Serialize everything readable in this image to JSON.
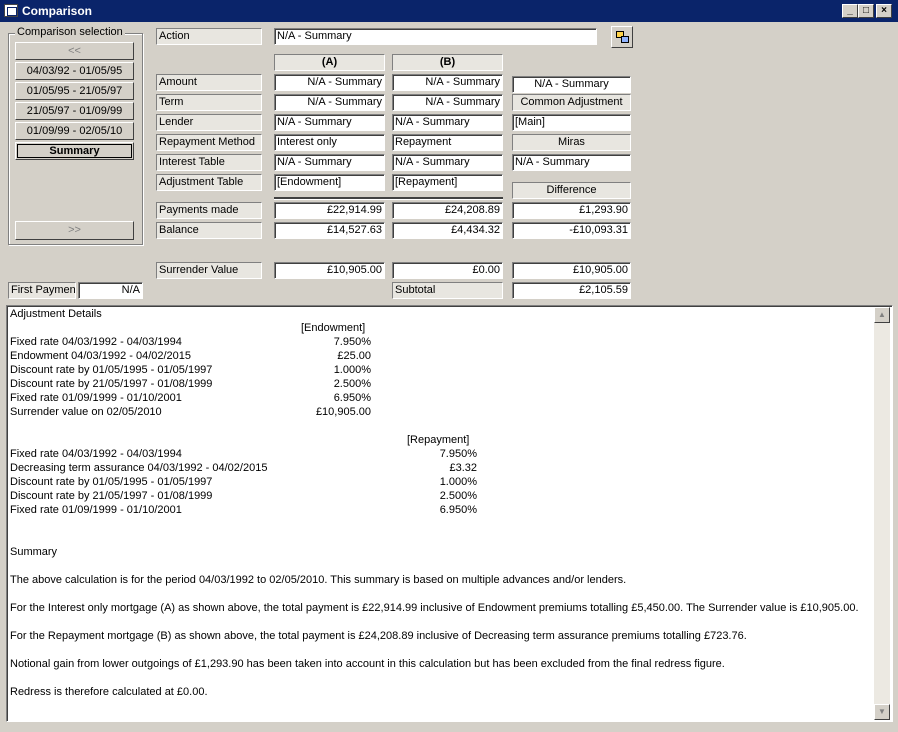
{
  "window": {
    "title": "Comparison",
    "minimize": "_",
    "maximize": "□",
    "close": "×"
  },
  "selection": {
    "label": "Comparison selection",
    "prev": "<<",
    "next": ">>",
    "items": [
      "04/03/92 - 01/05/95",
      "01/05/95 - 21/05/97",
      "21/05/97 - 01/09/99",
      "01/09/99 - 02/05/10",
      "Summary"
    ]
  },
  "action": {
    "label": "Action",
    "value": "N/A - Summary"
  },
  "columns": {
    "a": "(A)",
    "b": "(B)"
  },
  "rows": {
    "amount": {
      "label": "Amount",
      "a": "N/A - Summary",
      "b": "N/A - Summary"
    },
    "term": {
      "label": "Term",
      "a": "N/A - Summary",
      "b": "N/A - Summary"
    },
    "lender": {
      "label": "Lender",
      "a": "N/A - Summary",
      "b": "N/A - Summary"
    },
    "repayment": {
      "label": "Repayment Method",
      "a": "Interest only",
      "b": "Repayment"
    },
    "interest": {
      "label": "Interest Table",
      "a": "N/A - Summary",
      "b": "N/A - Summary"
    },
    "adjustment": {
      "label": "Adjustment Table",
      "a": "[Endowment]",
      "b": "[Repayment]"
    },
    "payments": {
      "label": "Payments made",
      "a": "£22,914.99",
      "b": "£24,208.89",
      "diff": "£1,293.90"
    },
    "balance": {
      "label": "Balance",
      "a": "£14,527.63",
      "b": "£4,434.32",
      "diff": "-£10,093.31"
    },
    "surrender": {
      "label": "Surrender Value",
      "a": "£10,905.00",
      "b": "£0.00",
      "diff": "£10,905.00"
    }
  },
  "right": {
    "amount": "N/A - Summary",
    "common_adjustment_label": "Common Adjustment",
    "common_adjustment": "[Main]",
    "miras_label": "Miras",
    "miras": "N/A - Summary",
    "difference_label": "Difference"
  },
  "first_payment": {
    "label": "First Payment",
    "value": "N/A"
  },
  "subtotal": {
    "label": "Subtotal",
    "value": "£2,105.59"
  },
  "details": {
    "title": "Adjustment Details",
    "endowment_header": "[Endowment]",
    "endowment": [
      {
        "text": "Fixed rate 04/03/1992 - 04/03/1994",
        "value": "7.950%"
      },
      {
        "text": "Endowment 04/03/1992 - 04/02/2015",
        "value": "£25.00"
      },
      {
        "text": "Discount rate by 01/05/1995 - 01/05/1997",
        "value": "1.000%"
      },
      {
        "text": "Discount rate by 21/05/1997 - 01/08/1999",
        "value": "2.500%"
      },
      {
        "text": "Fixed rate 01/09/1999 - 01/10/2001",
        "value": "6.950%"
      },
      {
        "text": "Surrender value on 02/05/2010",
        "value": "£10,905.00"
      }
    ],
    "repayment_header": "[Repayment]",
    "repayment": [
      {
        "text": "Fixed rate 04/03/1992 - 04/03/1994",
        "value": "7.950%"
      },
      {
        "text": "Decreasing term assurance 04/03/1992 - 04/02/2015",
        "value": "£3.32"
      },
      {
        "text": "Discount rate by 01/05/1995 - 01/05/1997",
        "value": "1.000%"
      },
      {
        "text": "Discount rate by 21/05/1997 - 01/08/1999",
        "value": "2.500%"
      },
      {
        "text": "Fixed rate 01/09/1999 - 01/10/2001",
        "value": "6.950%"
      }
    ],
    "summary_title": "Summary",
    "summary": [
      "The above calculation is for the period 04/03/1992 to 02/05/2010. This summary is based on multiple advances and/or lenders.",
      "For the Interest only mortgage (A) as shown above, the total payment is £22,914.99 inclusive of Endowment premiums totalling £5,450.00. The Surrender value is £10,905.00.",
      "For the Repayment mortgage (B) as shown above, the total payment is £24,208.89 inclusive of Decreasing term assurance premiums totalling £723.76.",
      "Notional gain from lower outgoings of £1,293.90 has been taken into account in this calculation but has been excluded from the final redress figure.",
      "Redress is therefore calculated at £0.00."
    ],
    "scroll_up": "▲",
    "scroll_down": "▼"
  }
}
